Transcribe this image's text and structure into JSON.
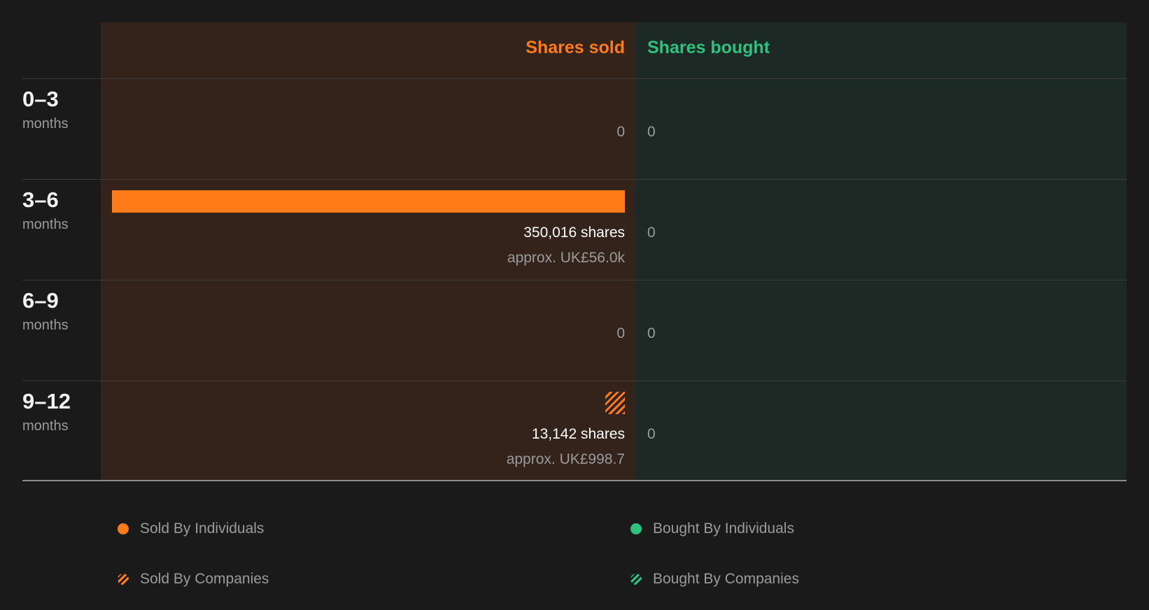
{
  "chart_data": {
    "type": "bar",
    "orientation": "horizontal",
    "headers": {
      "sold": "Shares sold",
      "bought": "Shares bought"
    },
    "periods": [
      {
        "range": "0–3",
        "unit": "months",
        "sold_individuals": 0,
        "sold_companies": 0,
        "bought_individuals": 0,
        "bought_companies": 0,
        "sold_zero": "0",
        "bought_zero": "0"
      },
      {
        "range": "3–6",
        "unit": "months",
        "sold_individuals": 350016,
        "sold_companies": 0,
        "bought_individuals": 0,
        "bought_companies": 0,
        "sold_shares_label": "350,016 shares",
        "sold_value_label": "approx. UK£56.0k",
        "bought_zero": "0"
      },
      {
        "range": "6–9",
        "unit": "months",
        "sold_individuals": 0,
        "sold_companies": 0,
        "bought_individuals": 0,
        "bought_companies": 0,
        "sold_zero": "0",
        "bought_zero": "0"
      },
      {
        "range": "9–12",
        "unit": "months",
        "sold_individuals": 0,
        "sold_companies": 13142,
        "bought_individuals": 0,
        "bought_companies": 0,
        "sold_shares_label": "13,142 shares",
        "sold_value_label": "approx. UK£998.7",
        "bought_zero": "0"
      }
    ],
    "legend": [
      {
        "label": "Sold By Individuals",
        "style": "solid",
        "color": "#ff7b1a"
      },
      {
        "label": "Bought By Individuals",
        "style": "solid",
        "color": "#2ec27e"
      },
      {
        "label": "Sold By Companies",
        "style": "striped",
        "color": "#ff7b1a"
      },
      {
        "label": "Bought By Companies",
        "style": "striped",
        "color": "#2ec27e"
      }
    ],
    "colors": {
      "sold": "#ff7b1a",
      "bought": "#2ec27e"
    }
  }
}
